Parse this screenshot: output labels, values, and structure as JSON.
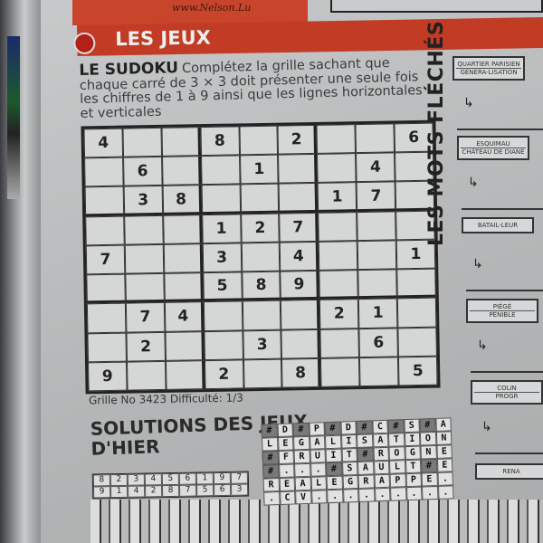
{
  "header": {
    "ad_text": "www.Nelson.Lu",
    "section_title": "LES JEUX"
  },
  "sudoku": {
    "title": "LE SUDOKU",
    "instructions": "Complétez la grille sachant que chaque carré de 3 × 3 doit présenter une seule fois les chiffres de 1 à 9 ainsi que les lignes horizontales et verticales",
    "grid": [
      [
        "4",
        "",
        "",
        "8",
        "",
        "2",
        "",
        "",
        "6"
      ],
      [
        "",
        "6",
        "",
        "",
        "1",
        "",
        "",
        "4",
        ""
      ],
      [
        "",
        "3",
        "8",
        "",
        "",
        "",
        "1",
        "7",
        ""
      ],
      [
        "",
        "",
        "",
        "1",
        "2",
        "7",
        "",
        "",
        ""
      ],
      [
        "7",
        "",
        "",
        "3",
        "",
        "4",
        "",
        "",
        "1"
      ],
      [
        "",
        "",
        "",
        "5",
        "8",
        "9",
        "",
        "",
        ""
      ],
      [
        "",
        "7",
        "4",
        "",
        "",
        "",
        "2",
        "1",
        ""
      ],
      [
        "",
        "2",
        "",
        "",
        "3",
        "",
        "",
        "6",
        ""
      ],
      [
        "9",
        "",
        "",
        "2",
        "",
        "8",
        "",
        "",
        "5"
      ]
    ],
    "footer": "Grille No 3423  Difficulté: 1/3"
  },
  "solutions": {
    "title": "SOLUTIONS DES JEUX D'HIER",
    "sudoku_rows": [
      [
        "8",
        "2",
        "3",
        "4",
        "5",
        "6",
        "1",
        "9",
        "7"
      ],
      [
        "9",
        "1",
        "4",
        "2",
        "8",
        "7",
        "5",
        "6",
        "3"
      ]
    ],
    "crossword_rows": [
      "#D#P#D#C#S#A",
      "LEGALISATION",
      "#FRUIT#ROGNE",
      "#...#SAULT#E",
      "REALEGRAPPE.",
      ".CV........."
    ]
  },
  "mots_fleches": {
    "title": "LES MOTS FLÉCHÉS",
    "clues": [
      {
        "lines": [
          "QUARTIER PARISIEN",
          "GÉNÉRA-LISATION"
        ]
      },
      {
        "lines": [
          "ESQUIMAU",
          "CHÂTEAU DE DIANE"
        ]
      },
      {
        "lines": [
          "BATAIL-LEUR"
        ]
      },
      {
        "lines": [
          "PIÉGÉ",
          "PÉNIBLE"
        ]
      },
      {
        "lines": [
          "COLIN",
          "PROGR"
        ]
      },
      {
        "lines": [
          "RENA"
        ]
      }
    ]
  },
  "colors": {
    "accent_red": "#c13b25",
    "paper": "#c0c2c3",
    "ink": "#222222"
  }
}
